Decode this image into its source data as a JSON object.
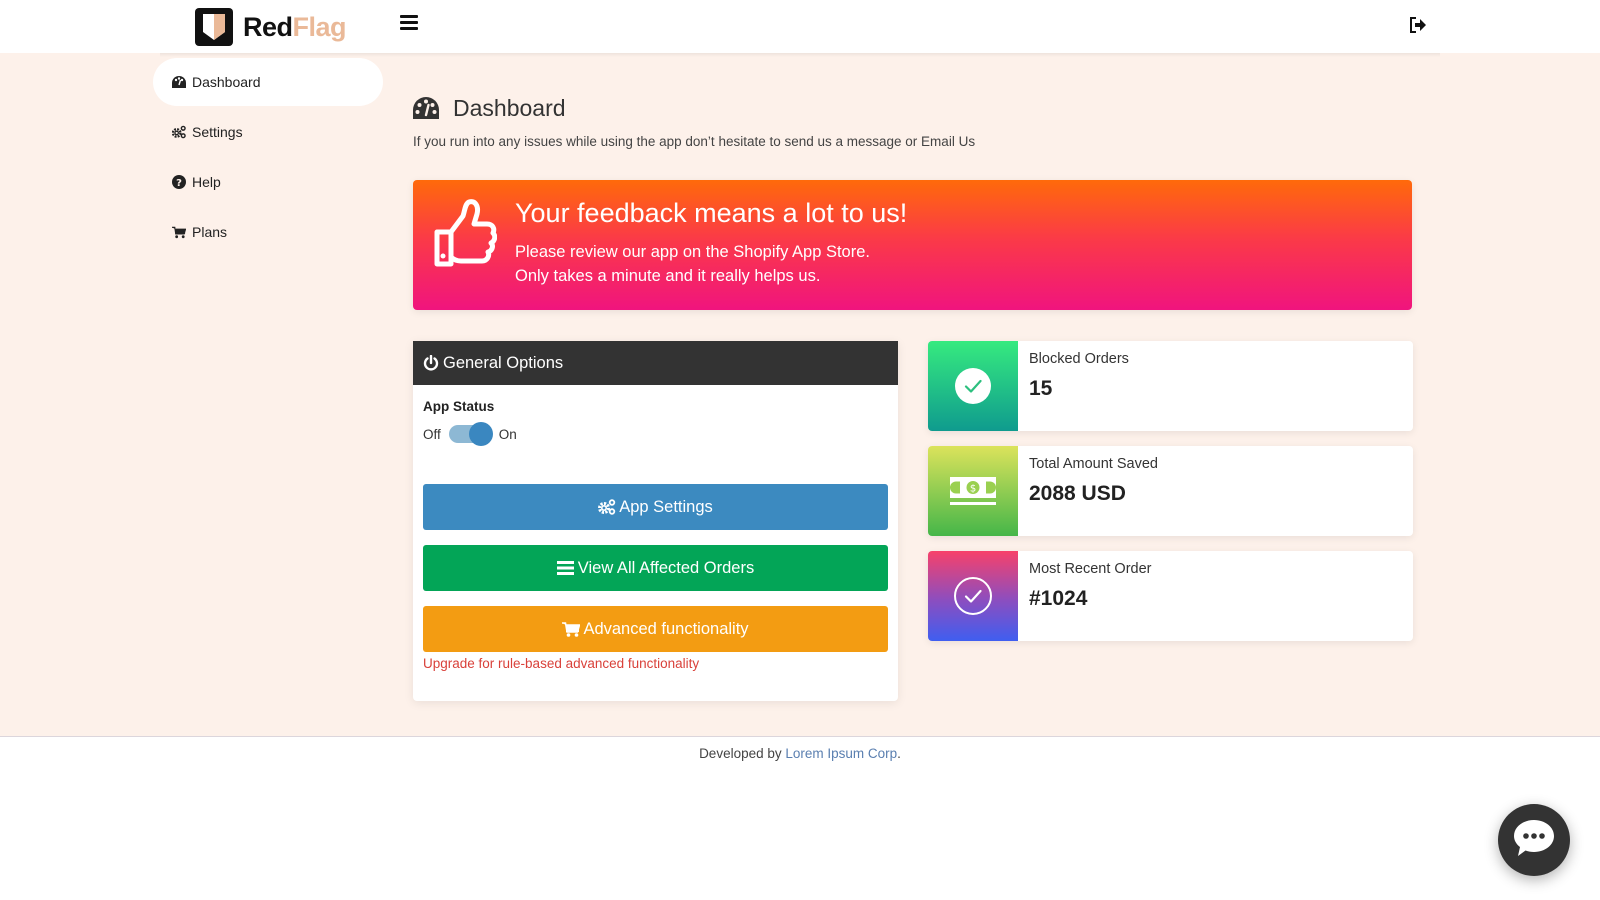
{
  "header": {
    "logo": {
      "part1": "Red",
      "part2": "Flag",
      "icon": "shield-logo-icon"
    },
    "menu_icon": "hamburger-icon",
    "logout_icon": "sign-out-icon"
  },
  "sidebar": {
    "items": [
      {
        "label": "Dashboard",
        "icon": "tachometer-icon",
        "active": true
      },
      {
        "label": "Settings",
        "icon": "cogs-icon",
        "active": false
      },
      {
        "label": "Help",
        "icon": "question-circle-icon",
        "active": false
      },
      {
        "label": "Plans",
        "icon": "shopping-cart-icon",
        "active": false
      }
    ]
  },
  "page": {
    "title": "Dashboard",
    "subtitle": "If you run into any issues while using the app don’t hesitate to send us a message or Email Us"
  },
  "banner": {
    "title": "Your feedback means a lot to us!",
    "line1": "Please review our app on the Shopify App Store.",
    "line2": "Only takes a minute and it really helps us.",
    "icon": "thumbs-up-icon",
    "gradient": [
      "#ff6a0a",
      "#f0147e"
    ]
  },
  "general_options": {
    "title": "General Options",
    "app_status_label": "App Status",
    "toggle": {
      "off_label": "Off",
      "on_label": "On",
      "state": "on"
    },
    "buttons": {
      "app_settings": "App Settings",
      "view_orders": "View All Affected Orders",
      "advanced": "Advanced functionality"
    },
    "upgrade_note": "Upgrade for rule-based advanced functionality"
  },
  "stats": [
    {
      "label": "Blocked Orders",
      "value": "15",
      "icon": "check-circle-icon"
    },
    {
      "label": "Total Amount Saved",
      "value": "2088 USD",
      "icon": "money-bill-icon"
    },
    {
      "label": "Most Recent Order",
      "value": "#1024",
      "icon": "check-circle-outline-icon"
    }
  ],
  "footer": {
    "prefix": "Developed by ",
    "company": "Lorem Ipsum Corp",
    "suffix": "."
  },
  "colors": {
    "page_bg": "#fdf1ea",
    "brand_accent": "#eab998",
    "btn_settings": "#3c8ac0",
    "btn_orders": "#03a557",
    "btn_advanced": "#f39c12",
    "warning_text": "#d9413a"
  }
}
